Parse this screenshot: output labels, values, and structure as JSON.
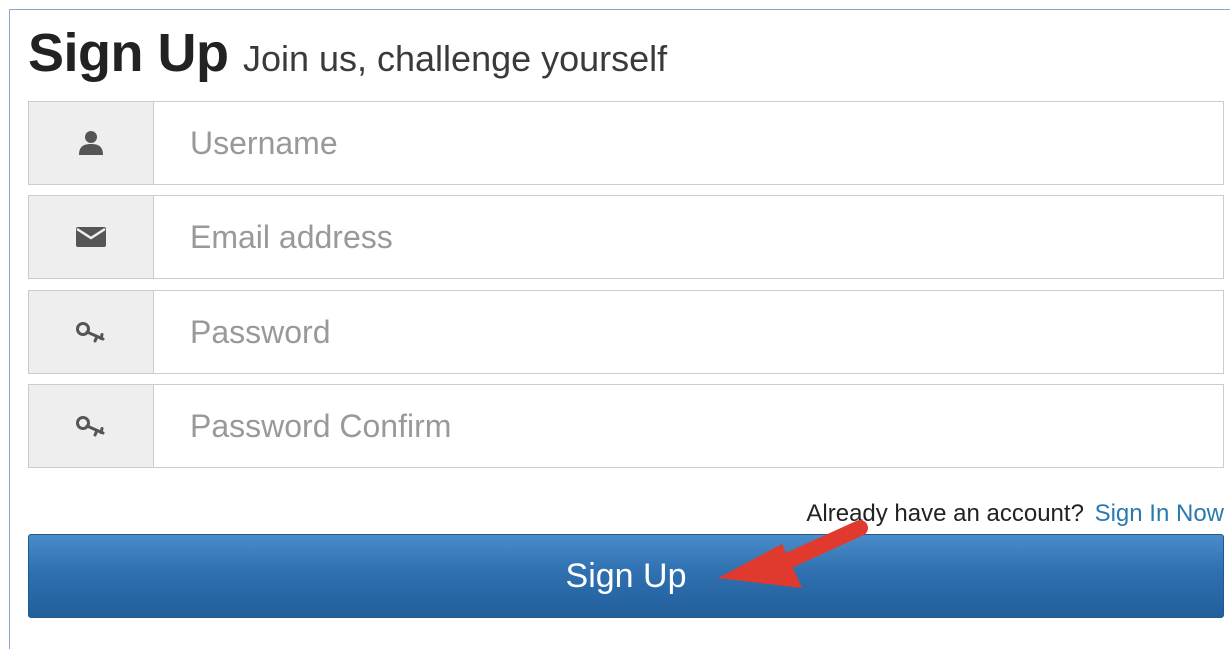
{
  "header": {
    "title": "Sign Up",
    "subtitle": "Join us, challenge yourself"
  },
  "form": {
    "username": {
      "placeholder": "Username",
      "icon": "user-icon"
    },
    "email": {
      "placeholder": "Email address",
      "icon": "envelope-icon"
    },
    "password": {
      "placeholder": "Password",
      "icon": "key-icon"
    },
    "password_confirm": {
      "placeholder": "Password Confirm",
      "icon": "key-icon"
    }
  },
  "signin": {
    "prompt": "Already have an account?",
    "link_label": "Sign In Now"
  },
  "submit": {
    "label": "Sign Up"
  },
  "colors": {
    "button": "#2f70b0",
    "link": "#2a7ab0",
    "annotation_arrow": "#e03a2e"
  }
}
